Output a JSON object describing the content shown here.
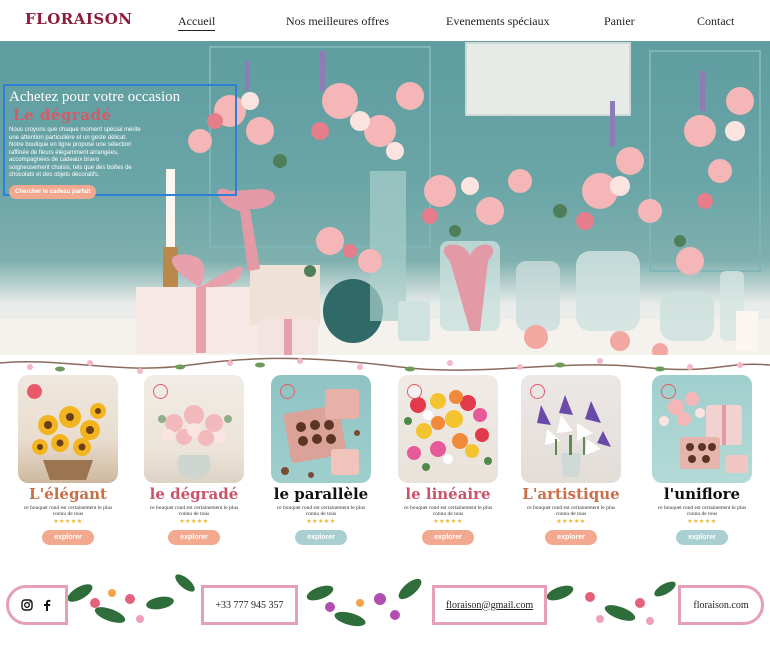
{
  "brand": {
    "logo": "FLORAISON"
  },
  "nav": {
    "items": [
      {
        "label": "Accueil",
        "active": true
      },
      {
        "label": "Nos meilleures offres"
      },
      {
        "label": "Evenements spéciaux"
      },
      {
        "label": "Panier"
      },
      {
        "label": "Contact"
      }
    ]
  },
  "hero": {
    "title": "Achetez pour votre occasion",
    "subtitle": "Le dégradé",
    "text": "Nous croyons que chaque moment spécial mérite une attention particulière et un geste délicat. Notre boutique en ligne propose une sélection raffinée de fleurs élégamment arrangées, accompagnées de cadeaux bravo soigneusement choisis, tels que des boîtes de chocolats et des objets décoratifs.",
    "button": "Chercher le cadeau parfait"
  },
  "cards": [
    {
      "name": "L'élégant",
      "desc": "ce bouquet rond est certainement le plus connu de tous",
      "stars": "★★★★★",
      "button": "explorer",
      "name_color": "#c96f4a",
      "button_color": "#f3a98f",
      "icon": "camera-icon"
    },
    {
      "name": "le dégradé",
      "desc": "ce bouquet rond est certainement le plus connu de tous",
      "stars": "★★★★★",
      "button": "explorer",
      "name_color": "#c9536a",
      "button_color": "#f3a98f",
      "icon": "camera-icon"
    },
    {
      "name": "le parallèle",
      "desc": "ce bouquet rond est certainement le plus connu de tous",
      "stars": "★★★★★",
      "button": "explorer",
      "name_color": "#111111",
      "button_color": "#a9cfd0",
      "icon": "camera-icon"
    },
    {
      "name": "le linéaire",
      "desc": "ce bouquet rond est certainement le plus connu de tous",
      "stars": "★★★★★",
      "button": "explorer",
      "name_color": "#c9536a",
      "button_color": "#f3a98f",
      "icon": "camera-icon"
    },
    {
      "name": "L'artistique",
      "desc": "ce bouquet rond est certainement le plus connu de tous",
      "stars": "★★★★★",
      "button": "explorer",
      "name_color": "#c96f4a",
      "button_color": "#f3a98f",
      "icon": "camera-icon"
    },
    {
      "name": "l'uniflore",
      "desc": "ce bouquet rond est certainement le plus connu de tous",
      "stars": "★★★★★",
      "button": "explorer",
      "name_color": "#111111",
      "button_color": "#a9cfd0",
      "icon": "camera-icon"
    }
  ],
  "footer": {
    "phone": "+33 777 945 357",
    "email": "floraison@gmail.com",
    "site": "floraison.com",
    "social": [
      "instagram-icon",
      "facebook-icon"
    ]
  },
  "colors": {
    "brand": "#8c1c3a",
    "accent": "#f3a98f",
    "border": "#e6a0b5",
    "teal": "#5f9da0"
  }
}
